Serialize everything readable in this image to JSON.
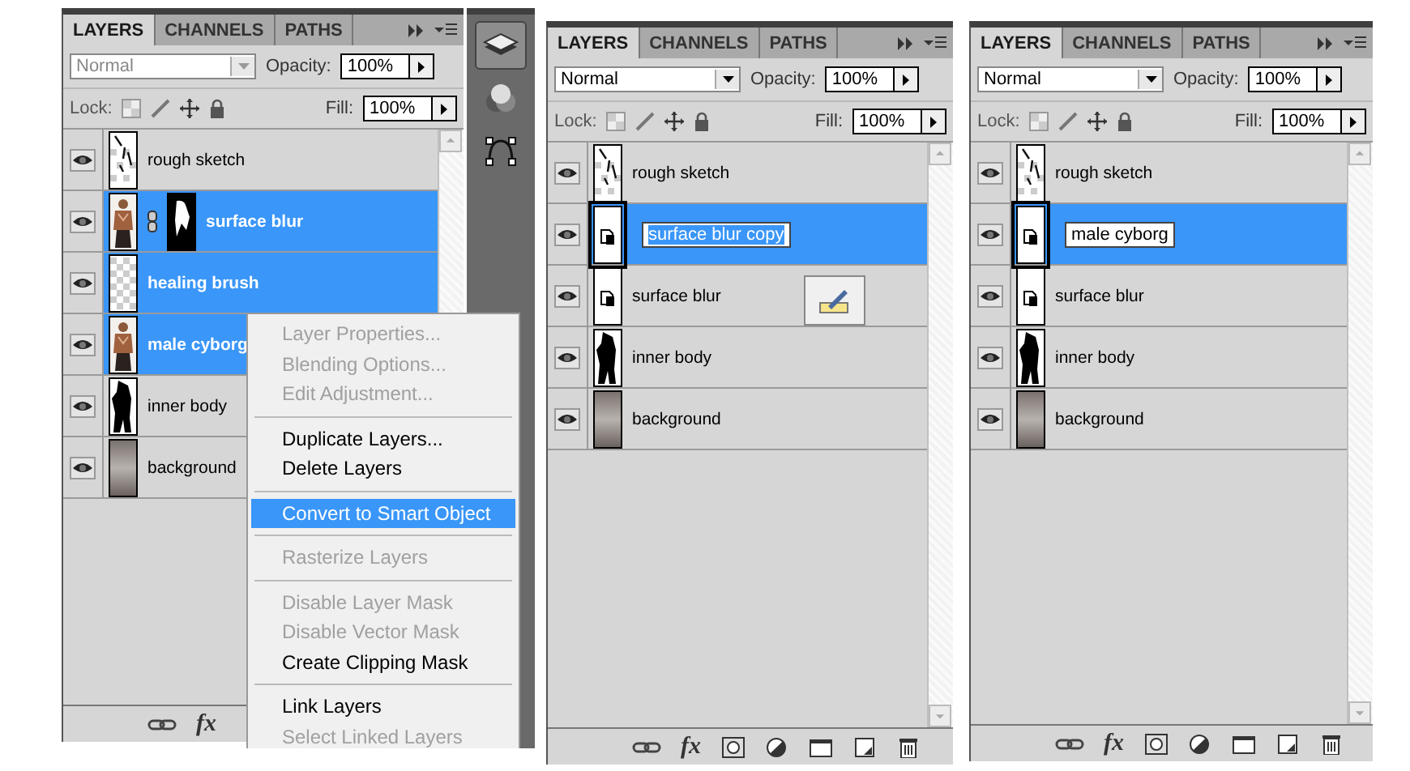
{
  "panels": [
    {
      "tabs": [
        {
          "label": "LAYERS",
          "selected": true
        },
        {
          "label": "CHANNELS",
          "selected": false
        },
        {
          "label": "PATHS",
          "selected": false
        }
      ],
      "blend_mode": "Normal",
      "blend_disabled": true,
      "opacity_label": "Opacity:",
      "opacity": "100%",
      "lock_label": "Lock:",
      "fill_label": "Fill:",
      "fill": "100%",
      "fx_label": "fx",
      "pen_button": false,
      "layers": [
        {
          "name": "rough sketch",
          "visible": true,
          "selected": false,
          "editing": false,
          "kind": "sketch",
          "mask": false
        },
        {
          "name": "surface blur",
          "visible": true,
          "selected": true,
          "editing": false,
          "kind": "photo",
          "mask": true
        },
        {
          "name": "healing brush",
          "visible": true,
          "selected": true,
          "editing": false,
          "kind": "checker",
          "mask": false
        },
        {
          "name": "male cyborg",
          "visible": true,
          "selected": true,
          "editing": false,
          "kind": "photo",
          "mask": false
        },
        {
          "name": "inner body",
          "visible": true,
          "selected": false,
          "editing": false,
          "kind": "silhouette",
          "mask": false
        },
        {
          "name": "background",
          "visible": true,
          "selected": false,
          "editing": false,
          "kind": "gradient",
          "mask": false
        }
      ],
      "dock": [
        {
          "kind": "layers",
          "selected": true
        },
        {
          "kind": "channels",
          "selected": false
        },
        {
          "kind": "paths",
          "selected": false
        }
      ],
      "context_menu": {
        "groups": [
          {
            "items": [
              {
                "label": "Layer Properties...",
                "disabled": true,
                "selected": false
              },
              {
                "label": "Blending Options...",
                "disabled": true,
                "selected": false
              },
              {
                "label": "Edit Adjustment...",
                "disabled": true,
                "selected": false
              }
            ]
          },
          {
            "items": [
              {
                "label": "Duplicate Layers...",
                "disabled": false,
                "selected": false
              },
              {
                "label": "Delete Layers",
                "disabled": false,
                "selected": false
              }
            ]
          },
          {
            "items": [
              {
                "label": "Convert to Smart Object",
                "disabled": false,
                "selected": true
              }
            ]
          },
          {
            "items": [
              {
                "label": "Rasterize Layers",
                "disabled": true,
                "selected": false
              }
            ]
          },
          {
            "items": [
              {
                "label": "Disable Layer Mask",
                "disabled": true,
                "selected": false
              },
              {
                "label": "Disable Vector Mask",
                "disabled": true,
                "selected": false
              },
              {
                "label": "Create Clipping Mask",
                "disabled": false,
                "selected": false
              }
            ]
          },
          {
            "items": [
              {
                "label": "Link Layers",
                "disabled": false,
                "selected": false
              },
              {
                "label": "Select Linked Layers",
                "disabled": true,
                "selected": false
              }
            ]
          }
        ]
      }
    },
    {
      "tabs": [
        {
          "label": "LAYERS",
          "selected": true
        },
        {
          "label": "CHANNELS",
          "selected": false
        },
        {
          "label": "PATHS",
          "selected": false
        }
      ],
      "blend_mode": "Normal",
      "blend_disabled": false,
      "opacity_label": "Opacity:",
      "opacity": "100%",
      "lock_label": "Lock:",
      "fill_label": "Fill:",
      "fill": "100%",
      "fx_label": "fx",
      "pen_button": true,
      "layers": [
        {
          "name": "rough sketch",
          "visible": true,
          "selected": false,
          "editing": false,
          "kind": "sketch",
          "mask": false
        },
        {
          "name": "surface blur copy",
          "visible": true,
          "selected": true,
          "editing": true,
          "kind": "smart",
          "mask": false
        },
        {
          "name": "surface blur",
          "visible": true,
          "selected": false,
          "editing": false,
          "kind": "smart",
          "mask": false
        },
        {
          "name": "inner body",
          "visible": true,
          "selected": false,
          "editing": false,
          "kind": "silhouette",
          "mask": false
        },
        {
          "name": "background",
          "visible": true,
          "selected": false,
          "editing": false,
          "kind": "gradient",
          "mask": false
        }
      ]
    },
    {
      "tabs": [
        {
          "label": "LAYERS",
          "selected": true
        },
        {
          "label": "CHANNELS",
          "selected": false
        },
        {
          "label": "PATHS",
          "selected": false
        }
      ],
      "blend_mode": "Normal",
      "blend_disabled": false,
      "opacity_label": "Opacity:",
      "opacity": "100%",
      "lock_label": "Lock:",
      "fill_label": "Fill:",
      "fill": "100%",
      "fx_label": "fx",
      "pen_button": false,
      "layers": [
        {
          "name": "rough sketch",
          "visible": true,
          "selected": false,
          "editing": false,
          "kind": "sketch",
          "mask": false
        },
        {
          "name": "male cyborg",
          "visible": true,
          "selected": true,
          "editing": true,
          "kind": "smart",
          "mask": false
        },
        {
          "name": "surface blur",
          "visible": true,
          "selected": false,
          "editing": false,
          "kind": "smart",
          "mask": false
        },
        {
          "name": "inner body",
          "visible": true,
          "selected": false,
          "editing": false,
          "kind": "silhouette",
          "mask": false
        },
        {
          "name": "background",
          "visible": true,
          "selected": false,
          "editing": false,
          "kind": "gradient",
          "mask": false
        }
      ]
    }
  ]
}
